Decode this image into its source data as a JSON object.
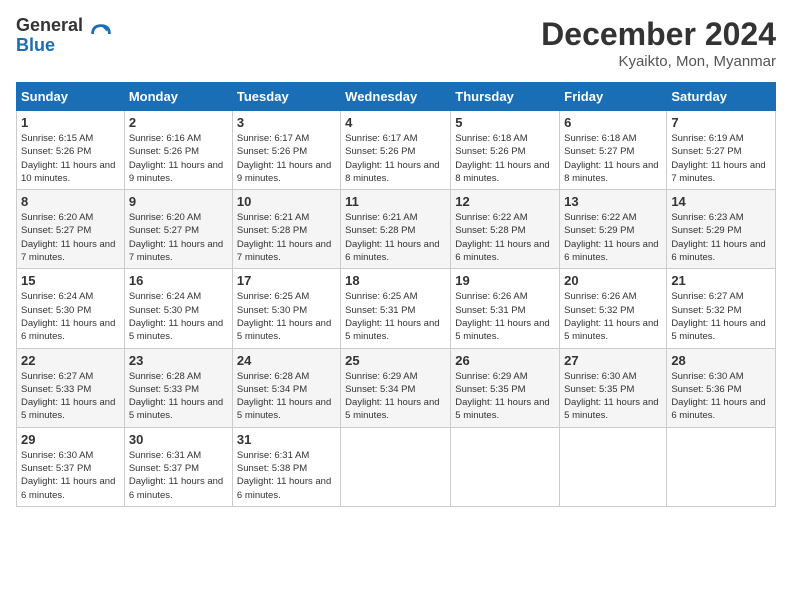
{
  "logo": {
    "general": "General",
    "blue": "Blue"
  },
  "title": "December 2024",
  "location": "Kyaikto, Mon, Myanmar",
  "days_header": [
    "Sunday",
    "Monday",
    "Tuesday",
    "Wednesday",
    "Thursday",
    "Friday",
    "Saturday"
  ],
  "weeks": [
    [
      {
        "day": "1",
        "sunrise": "6:15 AM",
        "sunset": "5:26 PM",
        "daylight": "11 hours and 10 minutes."
      },
      {
        "day": "2",
        "sunrise": "6:16 AM",
        "sunset": "5:26 PM",
        "daylight": "11 hours and 9 minutes."
      },
      {
        "day": "3",
        "sunrise": "6:17 AM",
        "sunset": "5:26 PM",
        "daylight": "11 hours and 9 minutes."
      },
      {
        "day": "4",
        "sunrise": "6:17 AM",
        "sunset": "5:26 PM",
        "daylight": "11 hours and 8 minutes."
      },
      {
        "day": "5",
        "sunrise": "6:18 AM",
        "sunset": "5:26 PM",
        "daylight": "11 hours and 8 minutes."
      },
      {
        "day": "6",
        "sunrise": "6:18 AM",
        "sunset": "5:27 PM",
        "daylight": "11 hours and 8 minutes."
      },
      {
        "day": "7",
        "sunrise": "6:19 AM",
        "sunset": "5:27 PM",
        "daylight": "11 hours and 7 minutes."
      }
    ],
    [
      {
        "day": "8",
        "sunrise": "6:20 AM",
        "sunset": "5:27 PM",
        "daylight": "11 hours and 7 minutes."
      },
      {
        "day": "9",
        "sunrise": "6:20 AM",
        "sunset": "5:27 PM",
        "daylight": "11 hours and 7 minutes."
      },
      {
        "day": "10",
        "sunrise": "6:21 AM",
        "sunset": "5:28 PM",
        "daylight": "11 hours and 7 minutes."
      },
      {
        "day": "11",
        "sunrise": "6:21 AM",
        "sunset": "5:28 PM",
        "daylight": "11 hours and 6 minutes."
      },
      {
        "day": "12",
        "sunrise": "6:22 AM",
        "sunset": "5:28 PM",
        "daylight": "11 hours and 6 minutes."
      },
      {
        "day": "13",
        "sunrise": "6:22 AM",
        "sunset": "5:29 PM",
        "daylight": "11 hours and 6 minutes."
      },
      {
        "day": "14",
        "sunrise": "6:23 AM",
        "sunset": "5:29 PM",
        "daylight": "11 hours and 6 minutes."
      }
    ],
    [
      {
        "day": "15",
        "sunrise": "6:24 AM",
        "sunset": "5:30 PM",
        "daylight": "11 hours and 6 minutes."
      },
      {
        "day": "16",
        "sunrise": "6:24 AM",
        "sunset": "5:30 PM",
        "daylight": "11 hours and 5 minutes."
      },
      {
        "day": "17",
        "sunrise": "6:25 AM",
        "sunset": "5:30 PM",
        "daylight": "11 hours and 5 minutes."
      },
      {
        "day": "18",
        "sunrise": "6:25 AM",
        "sunset": "5:31 PM",
        "daylight": "11 hours and 5 minutes."
      },
      {
        "day": "19",
        "sunrise": "6:26 AM",
        "sunset": "5:31 PM",
        "daylight": "11 hours and 5 minutes."
      },
      {
        "day": "20",
        "sunrise": "6:26 AM",
        "sunset": "5:32 PM",
        "daylight": "11 hours and 5 minutes."
      },
      {
        "day": "21",
        "sunrise": "6:27 AM",
        "sunset": "5:32 PM",
        "daylight": "11 hours and 5 minutes."
      }
    ],
    [
      {
        "day": "22",
        "sunrise": "6:27 AM",
        "sunset": "5:33 PM",
        "daylight": "11 hours and 5 minutes."
      },
      {
        "day": "23",
        "sunrise": "6:28 AM",
        "sunset": "5:33 PM",
        "daylight": "11 hours and 5 minutes."
      },
      {
        "day": "24",
        "sunrise": "6:28 AM",
        "sunset": "5:34 PM",
        "daylight": "11 hours and 5 minutes."
      },
      {
        "day": "25",
        "sunrise": "6:29 AM",
        "sunset": "5:34 PM",
        "daylight": "11 hours and 5 minutes."
      },
      {
        "day": "26",
        "sunrise": "6:29 AM",
        "sunset": "5:35 PM",
        "daylight": "11 hours and 5 minutes."
      },
      {
        "day": "27",
        "sunrise": "6:30 AM",
        "sunset": "5:35 PM",
        "daylight": "11 hours and 5 minutes."
      },
      {
        "day": "28",
        "sunrise": "6:30 AM",
        "sunset": "5:36 PM",
        "daylight": "11 hours and 6 minutes."
      }
    ],
    [
      {
        "day": "29",
        "sunrise": "6:30 AM",
        "sunset": "5:37 PM",
        "daylight": "11 hours and 6 minutes."
      },
      {
        "day": "30",
        "sunrise": "6:31 AM",
        "sunset": "5:37 PM",
        "daylight": "11 hours and 6 minutes."
      },
      {
        "day": "31",
        "sunrise": "6:31 AM",
        "sunset": "5:38 PM",
        "daylight": "11 hours and 6 minutes."
      },
      null,
      null,
      null,
      null
    ]
  ],
  "labels": {
    "sunrise": "Sunrise:",
    "sunset": "Sunset:",
    "daylight": "Daylight:"
  }
}
